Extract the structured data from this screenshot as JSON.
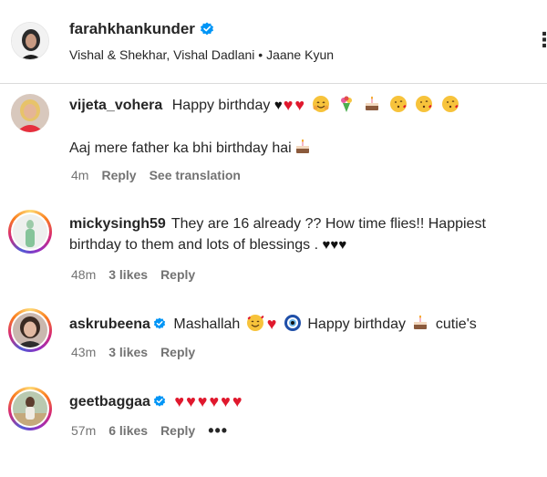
{
  "post": {
    "author": "farahkhankunder",
    "subtitle": "Vishal & Shekhar, Vishal Dadlani • Jaane Kyun",
    "more_icon": "more-horizontal-icon"
  },
  "comments": [
    {
      "username": "vijeta_vohera",
      "verified": false,
      "text_1": "Happy birthday",
      "text_2": "Aaj mere father ka bhi birthday hai",
      "time": "4m",
      "reply": "Reply",
      "translation": "See translation"
    },
    {
      "username": "mickysingh59",
      "verified": false,
      "text_1": "They are 16 already ?? How time flies!! Happiest birthday to them and lots of blessings .",
      "time": "48m",
      "likes": "3 likes",
      "reply": "Reply"
    },
    {
      "username": "askrubeena",
      "verified": true,
      "text_1": "Mashallah",
      "text_2": "Happy birthday",
      "text_3": "cutie's",
      "time": "43m",
      "likes": "3 likes",
      "reply": "Reply"
    },
    {
      "username": "geetbaggaa",
      "verified": true,
      "time": "57m",
      "likes": "6 likes",
      "reply": "Reply",
      "more": "•••"
    }
  ],
  "colors": {
    "verified": "#0095f6",
    "heart": "#e0182d",
    "meta_text": "#737373",
    "text": "#262626",
    "divider": "#dbdbdb"
  }
}
